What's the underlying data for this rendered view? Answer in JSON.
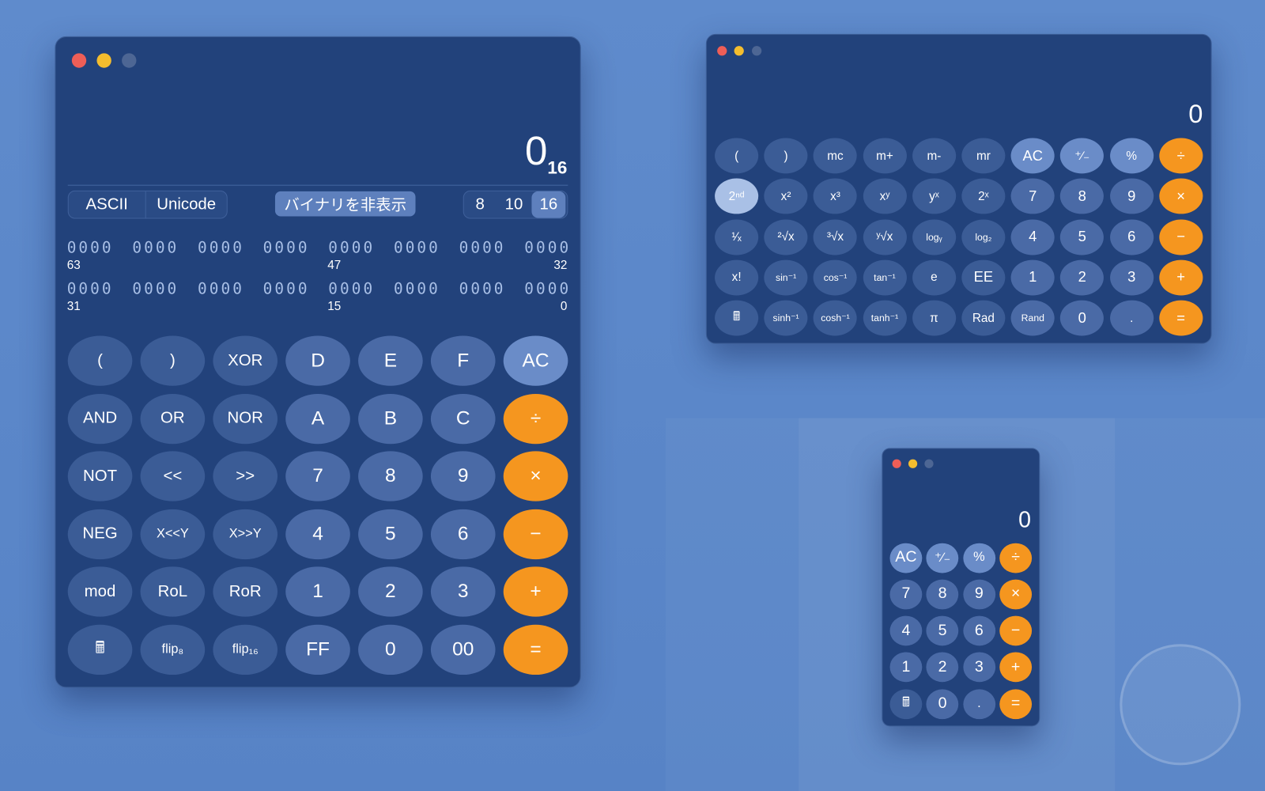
{
  "colors": {
    "window": "#22427b",
    "function_button": "#3b5c96",
    "digit_button": "#4a6aa6",
    "clear_button": "#6a8cc8",
    "operator_button": "#f5961f",
    "close": "#ee5e57",
    "minimize": "#f4bd2e",
    "zoom_inactive": "#4d6694"
  },
  "programmer": {
    "display": {
      "value": "0",
      "base_subscript": "16"
    },
    "encoding_tabs": [
      "ASCII",
      "Unicode"
    ],
    "binary_toggle": "バイナリを非表示",
    "base_tabs": [
      "8",
      "10",
      "16"
    ],
    "selected_base": "16",
    "binary_rows": [
      {
        "groups": [
          "0000",
          "0000",
          "0000",
          "0000",
          "0000",
          "0000",
          "0000",
          "0000"
        ],
        "labels": [
          "63",
          "47",
          "32"
        ]
      },
      {
        "groups": [
          "0000",
          "0000",
          "0000",
          "0000",
          "0000",
          "0000",
          "0000",
          "0000"
        ],
        "labels": [
          "31",
          "15",
          "0"
        ]
      }
    ],
    "buttons": [
      [
        [
          "(",
          "fn"
        ],
        [
          ")",
          "fn"
        ],
        [
          "XOR",
          "fn"
        ],
        [
          "D",
          "dg"
        ],
        [
          "E",
          "dg"
        ],
        [
          "F",
          "dg"
        ],
        [
          "AC",
          "ac"
        ]
      ],
      [
        [
          "AND",
          "fn"
        ],
        [
          "OR",
          "fn"
        ],
        [
          "NOR",
          "fn"
        ],
        [
          "A",
          "dg"
        ],
        [
          "B",
          "dg"
        ],
        [
          "C",
          "dg"
        ],
        [
          "÷",
          "op"
        ]
      ],
      [
        [
          "NOT",
          "fn"
        ],
        [
          "<<",
          "fn"
        ],
        [
          ">>",
          "fn"
        ],
        [
          "7",
          "dg"
        ],
        [
          "8",
          "dg"
        ],
        [
          "9",
          "dg"
        ],
        [
          "×",
          "op"
        ]
      ],
      [
        [
          "NEG",
          "fn"
        ],
        [
          "X<<Y",
          "fn"
        ],
        [
          "X>>Y",
          "fn"
        ],
        [
          "4",
          "dg"
        ],
        [
          "5",
          "dg"
        ],
        [
          "6",
          "dg"
        ],
        [
          "−",
          "op"
        ]
      ],
      [
        [
          "mod",
          "fn"
        ],
        [
          "RoL",
          "fn"
        ],
        [
          "RoR",
          "fn"
        ],
        [
          "1",
          "dg"
        ],
        [
          "2",
          "dg"
        ],
        [
          "3",
          "dg"
        ],
        [
          "+",
          "op"
        ]
      ],
      [
        [
          "🖩",
          "fn"
        ],
        [
          "flip₈",
          "fn"
        ],
        [
          "flip₁₆",
          "fn"
        ],
        [
          "FF",
          "dg"
        ],
        [
          "0",
          "dg"
        ],
        [
          "00",
          "dg"
        ],
        [
          "=",
          "op"
        ]
      ]
    ]
  },
  "scientific": {
    "display": {
      "value": "0"
    },
    "buttons": [
      [
        [
          "(",
          "fn"
        ],
        [
          ")",
          "fn"
        ],
        [
          "mc",
          "fn"
        ],
        [
          "m+",
          "fn"
        ],
        [
          "m-",
          "fn"
        ],
        [
          "mr",
          "fn"
        ],
        [
          "AC",
          "ac"
        ],
        [
          "⁺∕₋",
          "ac"
        ],
        [
          "%",
          "ac"
        ],
        [
          "÷",
          "op"
        ]
      ],
      [
        [
          "2ⁿᵈ",
          "sel2"
        ],
        [
          "x²",
          "fn"
        ],
        [
          "x³",
          "fn"
        ],
        [
          "xʸ",
          "fn"
        ],
        [
          "yˣ",
          "fn"
        ],
        [
          "2ˣ",
          "fn"
        ],
        [
          "7",
          "dg"
        ],
        [
          "8",
          "dg"
        ],
        [
          "9",
          "dg"
        ],
        [
          "×",
          "op"
        ]
      ],
      [
        [
          "¹∕ₓ",
          "fn"
        ],
        [
          "²√x",
          "fn"
        ],
        [
          "³√x",
          "fn"
        ],
        [
          "ʸ√x",
          "fn"
        ],
        [
          "logᵧ",
          "fn"
        ],
        [
          "log₂",
          "fn"
        ],
        [
          "4",
          "dg"
        ],
        [
          "5",
          "dg"
        ],
        [
          "6",
          "dg"
        ],
        [
          "−",
          "op"
        ]
      ],
      [
        [
          "x!",
          "fn"
        ],
        [
          "sin⁻¹",
          "fn"
        ],
        [
          "cos⁻¹",
          "fn"
        ],
        [
          "tan⁻¹",
          "fn"
        ],
        [
          "e",
          "fn"
        ],
        [
          "EE",
          "fn"
        ],
        [
          "1",
          "dg"
        ],
        [
          "2",
          "dg"
        ],
        [
          "3",
          "dg"
        ],
        [
          "+",
          "op"
        ]
      ],
      [
        [
          "🖩",
          "fn"
        ],
        [
          "sinh⁻¹",
          "fn"
        ],
        [
          "cosh⁻¹",
          "fn"
        ],
        [
          "tanh⁻¹",
          "fn"
        ],
        [
          "π",
          "fn"
        ],
        [
          "Rad",
          "fn"
        ],
        [
          "Rand",
          "dg"
        ],
        [
          "0",
          "dg"
        ],
        [
          ".",
          "dg"
        ],
        [
          "=",
          "op"
        ]
      ]
    ]
  },
  "basic": {
    "display": {
      "value": "0"
    },
    "buttons": [
      [
        [
          "AC",
          "ac"
        ],
        [
          "⁺∕₋",
          "ac"
        ],
        [
          "%",
          "ac"
        ],
        [
          "÷",
          "op"
        ]
      ],
      [
        [
          "7",
          "dg"
        ],
        [
          "8",
          "dg"
        ],
        [
          "9",
          "dg"
        ],
        [
          "×",
          "op"
        ]
      ],
      [
        [
          "4",
          "dg"
        ],
        [
          "5",
          "dg"
        ],
        [
          "6",
          "dg"
        ],
        [
          "−",
          "op"
        ]
      ],
      [
        [
          "1",
          "dg"
        ],
        [
          "2",
          "dg"
        ],
        [
          "3",
          "dg"
        ],
        [
          "+",
          "op"
        ]
      ],
      [
        [
          "🖩",
          "fn"
        ],
        [
          "0",
          "dg"
        ],
        [
          ".",
          "dg"
        ],
        [
          "=",
          "op"
        ]
      ]
    ]
  }
}
